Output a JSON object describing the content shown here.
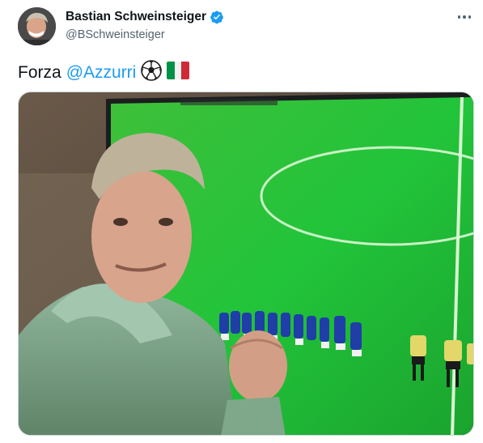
{
  "tweet": {
    "display_name": "Bastian Schweinsteiger",
    "handle": "@BSchweinsteiger",
    "text_prefix": "Forza",
    "mention": "@Azzurri",
    "emojis": [
      "soccer-ball",
      "italy-flag"
    ],
    "more_icon": "more-horizontal-icon",
    "verified_icon": "verified-badge-icon"
  },
  "colors": {
    "link": "#1d9bf0",
    "verified": "#1d9bf0",
    "text": "#0f1419",
    "secondary": "#536471"
  }
}
